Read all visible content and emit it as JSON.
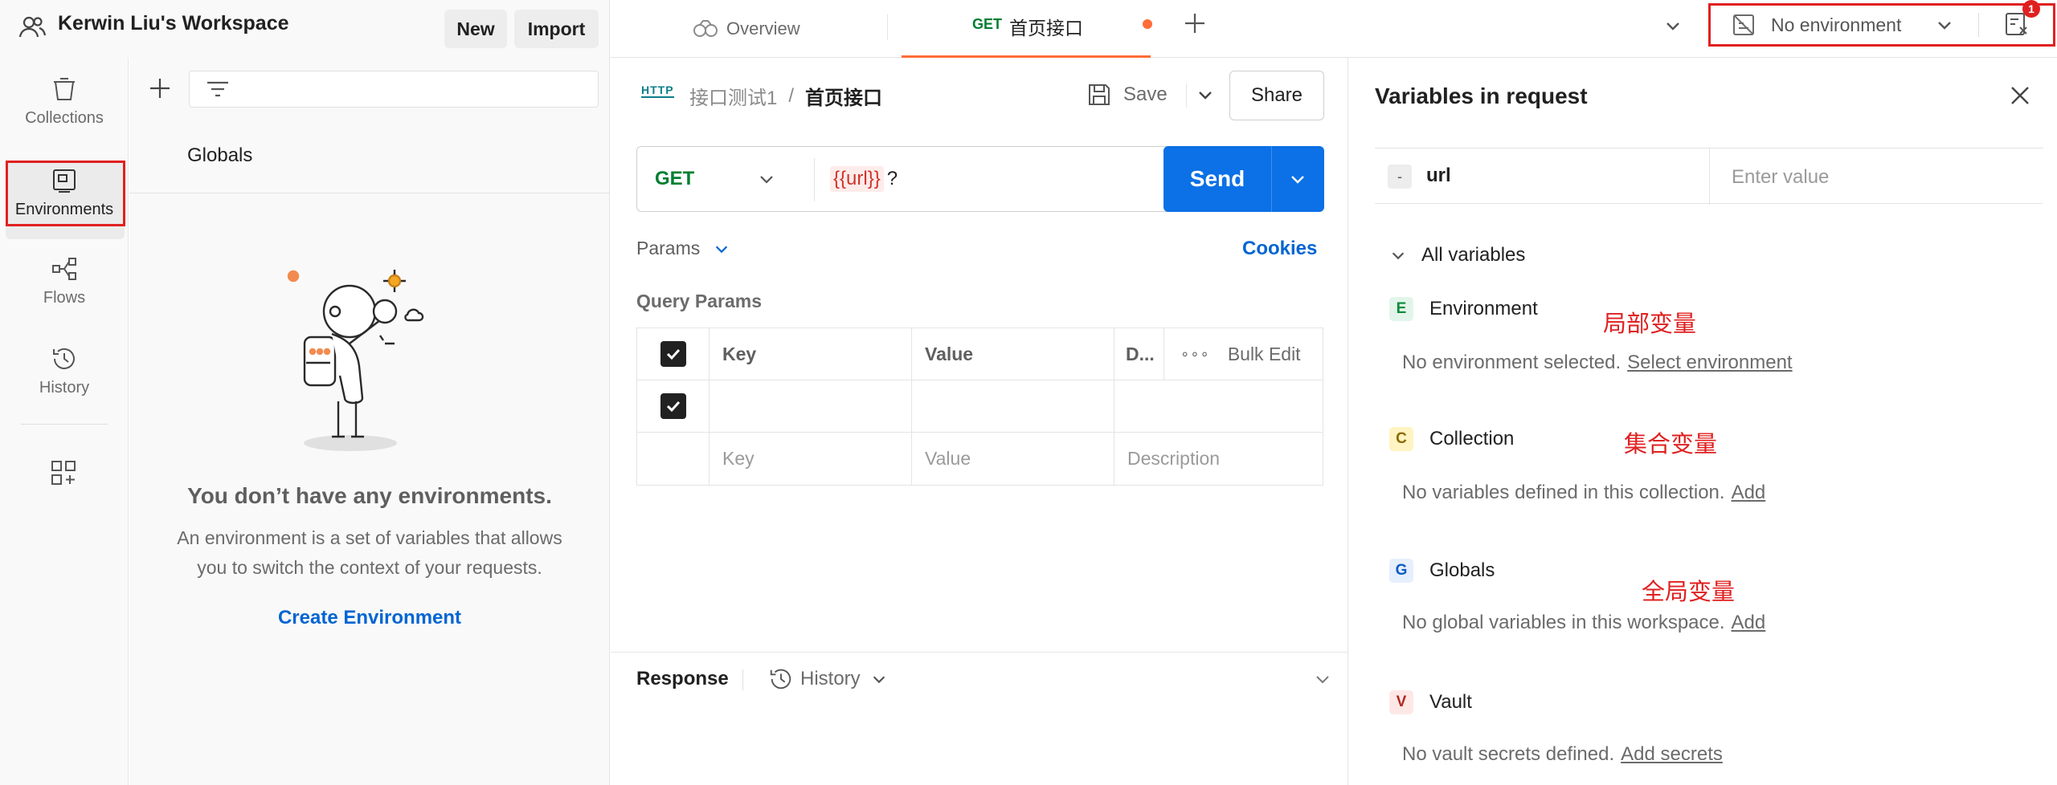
{
  "workspace": {
    "name": "Kerwin Liu's Workspace",
    "new_label": "New",
    "import_label": "Import"
  },
  "tabs": {
    "overview_label": "Overview",
    "request_method": "GET",
    "request_name": "首页接口"
  },
  "environment_selector": {
    "value": "No environment"
  },
  "notification_count": "1",
  "rail": {
    "collections": "Collections",
    "environments": "Environments",
    "flows": "Flows",
    "history": "History"
  },
  "env_sidebar": {
    "globals": "Globals",
    "empty_title": "You don’t have any environments.",
    "empty_desc_line1": "An environment is a set of variables that allows",
    "empty_desc_line2": "you to switch the context of your requests.",
    "create_label": "Create Environment"
  },
  "request": {
    "http_badge": "HTTP",
    "breadcrumb_collection": "接口测试1",
    "breadcrumb_separator": "/",
    "breadcrumb_request": "首页接口",
    "save_label": "Save",
    "share_label": "Share",
    "method": "GET",
    "url_variable": "{{url}}",
    "url_suffix": "?",
    "send_label": "Send",
    "params_label": "Params",
    "cookies_label": "Cookies",
    "query_params_label": "Query Params",
    "table": {
      "headers": {
        "key": "Key",
        "value": "Value",
        "description": "D...",
        "bulk_edit": "Bulk Edit"
      },
      "placeholders": {
        "key": "Key",
        "value": "Value",
        "description": "Description"
      }
    },
    "response_label": "Response",
    "history_label": "History"
  },
  "variables_panel": {
    "title": "Variables in request",
    "variable_name": "url",
    "variable_dash": "-",
    "value_placeholder": "Enter value",
    "all_variables": "All variables",
    "environment": {
      "badge": "E",
      "title": "Environment",
      "desc": "No environment selected.",
      "link": "Select environment",
      "note": "局部变量"
    },
    "collection": {
      "badge": "C",
      "title": "Collection",
      "desc": "No variables defined in this collection.",
      "link": "Add",
      "note": "集合变量"
    },
    "globals": {
      "badge": "G",
      "title": "Globals",
      "desc": "No global variables in this workspace.",
      "link": "Add",
      "note": "全局变量"
    },
    "vault": {
      "badge": "V",
      "title": "Vault",
      "desc": "No vault secrets defined.",
      "link": "Add secrets"
    }
  },
  "colors": {
    "accent_blue": "#0265d2",
    "send_blue": "#0c70e6",
    "get_green": "#007f31",
    "highlight_red": "#e02020",
    "tab_orange": "#ff6c37"
  }
}
